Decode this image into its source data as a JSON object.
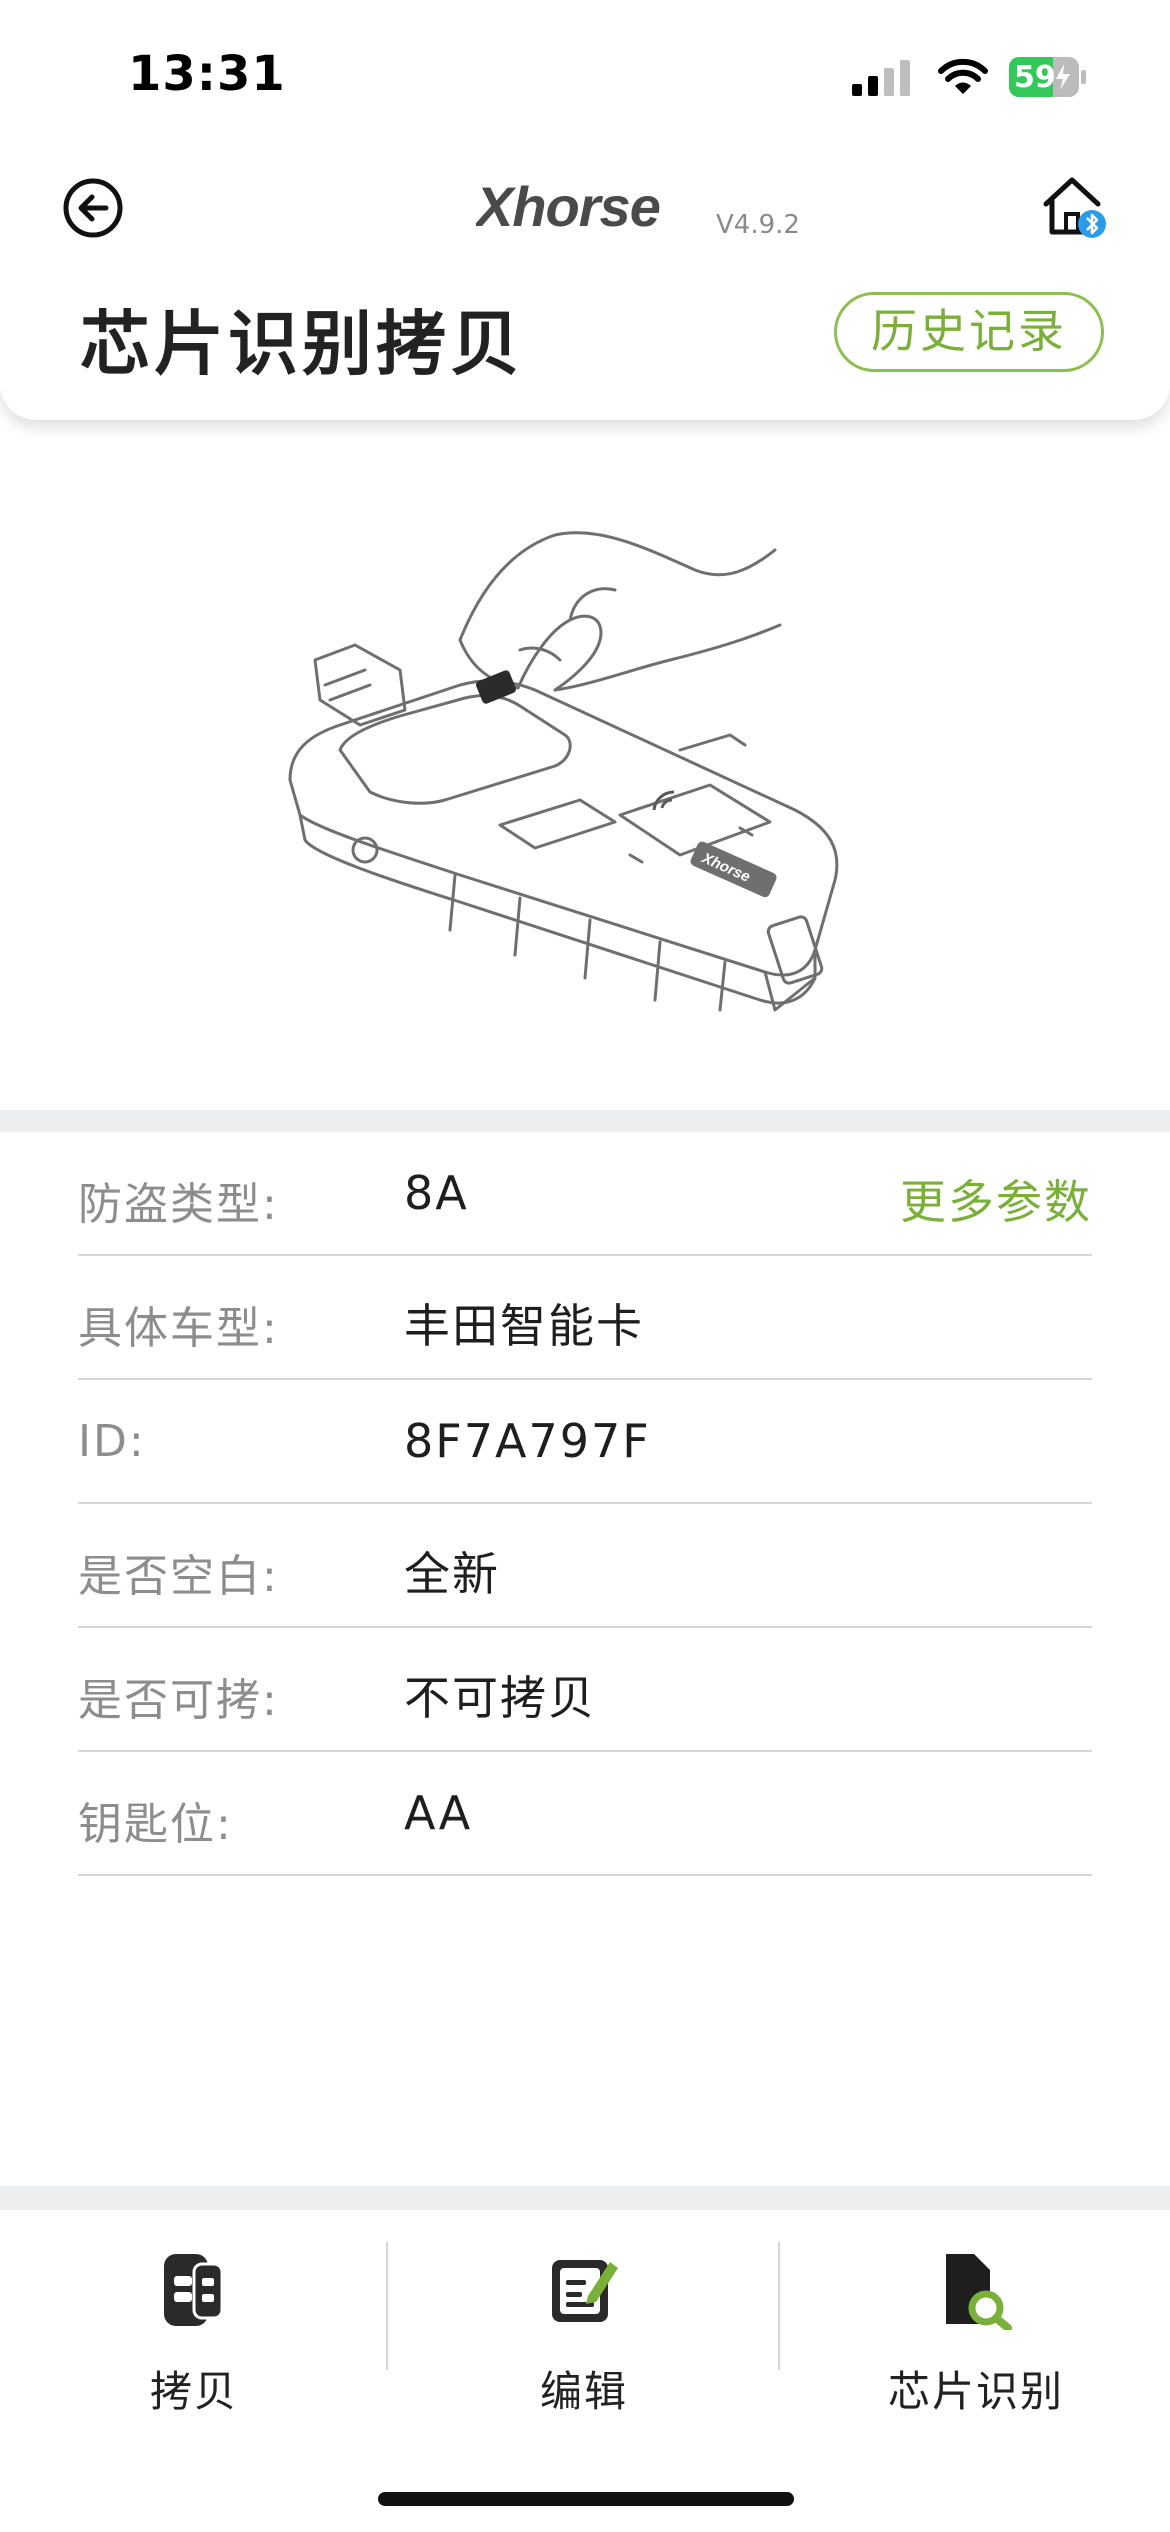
{
  "status_bar": {
    "time": "13:31",
    "battery_level": "59",
    "icons": [
      "signal-icon",
      "wifi-icon",
      "battery-charging-icon"
    ]
  },
  "header": {
    "back_icon": "back-arrow-circle-icon",
    "brand": "Xhorse",
    "version": "V4.9.2",
    "home_icon": "home-bluetooth-icon",
    "title": "芯片识别拷贝",
    "history_button": "历史记录"
  },
  "info": {
    "more_params": "更多参数",
    "rows": [
      {
        "label": "防盗类型:",
        "value": "8A"
      },
      {
        "label": "具体车型:",
        "value": "丰田智能卡"
      },
      {
        "label": "ID:",
        "value": "8F7A797F"
      },
      {
        "label": "是否空白:",
        "value": "全新"
      },
      {
        "label": "是否可拷:",
        "value": "不可拷贝"
      },
      {
        "label": "钥匙位:",
        "value": "AA"
      }
    ]
  },
  "bottom_nav": {
    "items": [
      {
        "label": "拷贝",
        "icon": "car-key-icon"
      },
      {
        "label": "编辑",
        "icon": "edit-document-icon"
      },
      {
        "label": "芯片识别",
        "icon": "chip-search-icon"
      }
    ]
  },
  "colors": {
    "accent_green": "#7ab03a",
    "battery_green": "#34c759",
    "bluetooth_blue": "#2c9be8"
  }
}
